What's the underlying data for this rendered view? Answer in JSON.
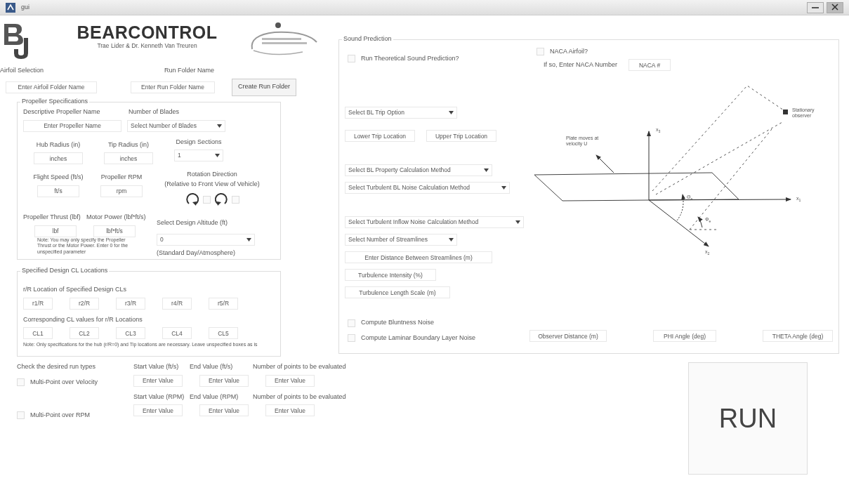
{
  "window": {
    "title": "gui"
  },
  "header": {
    "title": "BEARCONTROL",
    "authors": "Trae Lider & Dr. Kenneth Van Treuren"
  },
  "folders": {
    "airfoil_label": "Airfoil Selection",
    "run_label": "Run Folder Name",
    "airfoil_field": "Enter Airfoil Folder Name",
    "run_field": "Enter Run Folder Name",
    "create_button": "Create Run Folder"
  },
  "propeller": {
    "title": "Propeller Specifications",
    "name_label": "Descriptive Propeller Name",
    "name_field": "Enter Propeller Name",
    "blades_label": "Number of Blades",
    "blades_select": "Select Number of Blades",
    "hub_label": "Hub Radius (in)",
    "hub_field": "inches",
    "tip_label": "Tip Radius (in)",
    "tip_field": "inches",
    "sections_label": "Design Sections",
    "sections_select": "1",
    "speed_label": "Flight Speed (ft/s)",
    "speed_field": "ft/s",
    "rpm_label": "Propeller RPM",
    "rpm_field": "rpm",
    "rotation_label": [
      "Rotation Direction",
      "(Relative to Front View of Vehicle)"
    ],
    "rotation_options": [
      {
        "kind": "clockwise",
        "checked": false
      },
      {
        "kind": "counterclockwise",
        "checked": false
      }
    ],
    "thrust_label": "Propeller Thrust (lbf)",
    "power_label": "Motor Power (lbf*ft/s)",
    "thrust_field": "lbf",
    "power_field": "lbf*ft/s",
    "note": "Note: You may only specify the Propeller Thrust or the Motor Power. Enter 0 for the unspecified parameter",
    "altitude_label": "Select Design Altitude (ft)",
    "altitude_select": "0",
    "altitude_note": "(Standard Day/Atmosphere)"
  },
  "cl_panel": {
    "title": "Specified Design CL Locations",
    "locations_label": "r/R Location of Specified Design CLs",
    "locations": [
      "r1/R",
      "r2/R",
      "r3/R",
      "r4/R",
      "r5/R"
    ],
    "values_label": "Corresponding CL values for r/R Locations",
    "values": [
      "CL1",
      "CL2",
      "CL3",
      "CL4",
      "CL5"
    ],
    "note": "Note: Only specifications for the hub (r/R=0) and Tip locations are necessary. Leave unspecified boxes as is"
  },
  "sound": {
    "title": "Sound Prediction",
    "run_theoretical": {
      "label": "Run Theoretical Sound Prediction?",
      "checked": false
    },
    "naca": {
      "label": "NACA Airfoil?",
      "checked": false
    },
    "naca_prompt": "If so, Enter NACA Number",
    "naca_field": "NACA #",
    "trip_select": "Select BL Trip Option",
    "lower_trip_field": "Lower Trip Location",
    "upper_trip_field": "Upper Trip Location",
    "bl_property_select": "Select BL Property Calculation Method",
    "turbulent_bl_select": "Select Turbulent BL Noise Calculation Method",
    "inflow_select": "Select Turbulent Inflow Noise Calculation Method",
    "streamlines_select": "Select Number of Streamlines",
    "distance_field": "Enter Distance Between Streamlines (m)",
    "intensity_field": "Turbulence Intensity (%)",
    "length_scale_field": "Turbulence Length Scale (m)",
    "bluntness": {
      "label": "Compute Bluntness Noise",
      "checked": false
    },
    "laminar": {
      "label": "Compute Laminar Boundary Layer Noise",
      "checked": false
    },
    "observer_field": "Observer Distance (m)",
    "phi_field": "PHI Angle (deg)",
    "theta_field": "THETA Angle (deg)",
    "diagram": {
      "plate_label": "Plate moves at velocity U",
      "observer_label": "Stationary observer",
      "x3": "x$_{3}$",
      "x1": "x$_{1}$",
      "x2": "x$_{2}$",
      "theta": "Θ$_{e}$",
      "phi": "Φ$_{e}$"
    }
  },
  "run_types": {
    "title": "Check the desired run types",
    "velocity": {
      "label": "Multi-Point over Velocity",
      "checked": false
    },
    "rpm": {
      "label": "Multi-Point over RPM",
      "checked": false
    },
    "velocity_headers": [
      "Start Value (ft/s)",
      "End Value (ft/s)",
      "Number of points to be evaluated"
    ],
    "velocity_fields": [
      "Enter Value",
      "Enter Value",
      "Enter Value"
    ],
    "rpm_headers": [
      "Start Value (RPM)",
      "End Value (RPM)",
      "Number of points to be evaluated"
    ],
    "rpm_fields": [
      "Enter Value",
      "Enter Value",
      "Enter Value"
    ]
  },
  "run_button": "RUN"
}
